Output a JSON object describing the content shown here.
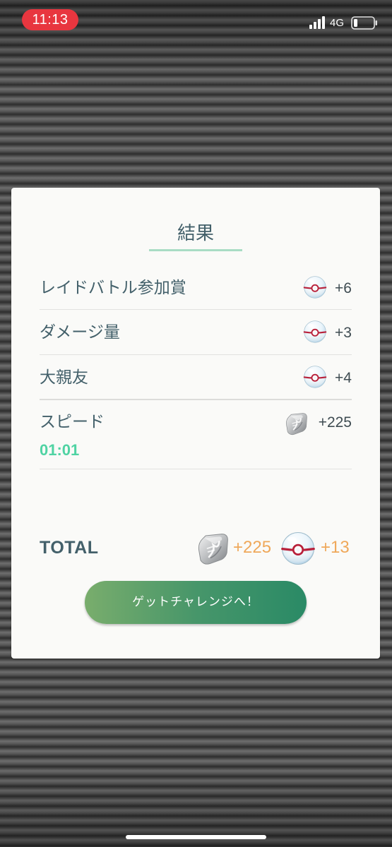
{
  "status_bar": {
    "time": "11:13",
    "network": "4G",
    "icons": [
      "signal-icon",
      "battery-icon"
    ]
  },
  "panel": {
    "title": "結果",
    "rows": [
      {
        "label": "レイドバトル参加賞",
        "value": "+6",
        "icon": "premier-ball-icon"
      },
      {
        "label": "ダメージ量",
        "value": "+3",
        "icon": "premier-ball-icon"
      },
      {
        "label": "大親友",
        "value": "+4",
        "icon": "premier-ball-icon"
      },
      {
        "label": "スピード",
        "sub": "01:01",
        "value": "+225",
        "icon": "stardust-icon"
      }
    ],
    "total": {
      "label": "TOTAL",
      "stardust": "+225",
      "balls": "+13"
    },
    "button_label": "ゲットチャレンジへ！"
  },
  "colors": {
    "title_underline": "#a8dcc4",
    "speed_time": "#4fd3a3",
    "total_amount": "#efa85a",
    "button_start": "#79ad6c",
    "button_end": "#2a8a66",
    "time_pill": "#e8363f"
  }
}
